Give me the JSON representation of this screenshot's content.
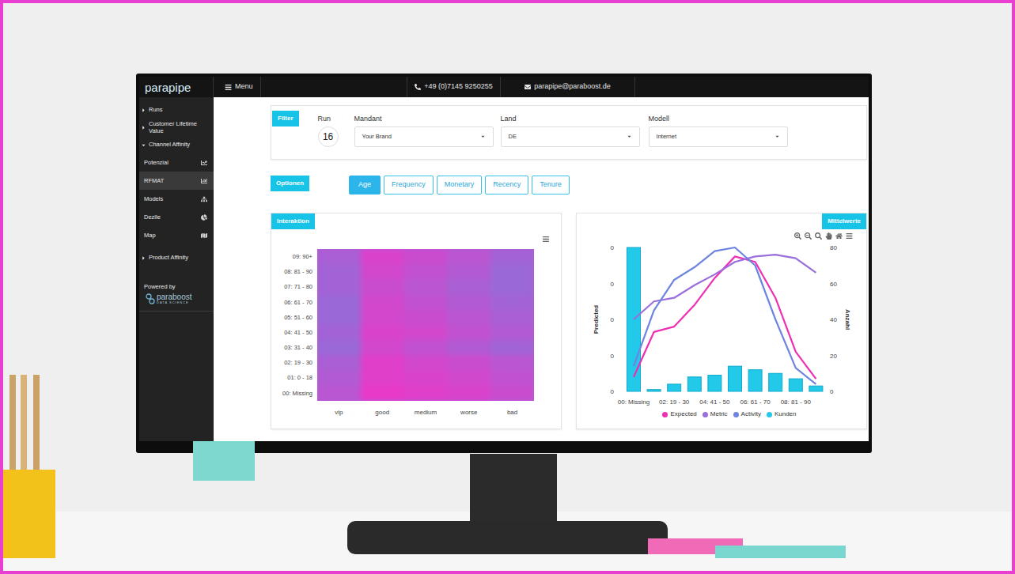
{
  "topbar": {
    "logo": "parapipe",
    "menu_label": "Menu",
    "phone": "+49 (0)7145 9250255",
    "email": "parapipe@paraboost.de"
  },
  "sidebar": {
    "items": [
      {
        "label": "Runs",
        "kind": "group",
        "expanded": false,
        "selected": false
      },
      {
        "label": "Customer Lifetime Value",
        "kind": "group",
        "expanded": false,
        "selected": false
      },
      {
        "label": "Channel Affinity",
        "kind": "group",
        "expanded": true,
        "selected": false
      },
      {
        "label": "Potenzial",
        "kind": "link",
        "selected": false
      },
      {
        "label": "RFMAT",
        "kind": "link",
        "selected": true
      },
      {
        "label": "Models",
        "kind": "link",
        "selected": false
      },
      {
        "label": "Dezile",
        "kind": "link",
        "selected": false
      },
      {
        "label": "Map",
        "kind": "link",
        "selected": false
      },
      {
        "label": "Product Affinity",
        "kind": "group",
        "expanded": false,
        "selected": false
      }
    ],
    "powered_by": "Powered by",
    "brand": "paraboost",
    "brand_tagline": "DATA SCIENCE"
  },
  "filter": {
    "title": "Filter",
    "run": {
      "label": "Run",
      "value": "16"
    },
    "selects": [
      {
        "label": "Mandant",
        "value": "Your Brand"
      },
      {
        "label": "Land",
        "value": "DE"
      },
      {
        "label": "Modell",
        "value": "Internet"
      }
    ]
  },
  "options": {
    "title": "Optionen",
    "tabs": [
      {
        "label": "Age",
        "selected": true
      },
      {
        "label": "Frequency",
        "selected": false
      },
      {
        "label": "Monetary",
        "selected": false
      },
      {
        "label": "Recency",
        "selected": false
      },
      {
        "label": "Tenure",
        "selected": false
      }
    ]
  },
  "heatmap": {
    "title": "Interaktion",
    "columns": [
      "vip",
      "good",
      "medium",
      "worse",
      "bad"
    ],
    "rows": [
      {
        "label": "09: 90+",
        "values": [
          0.6,
          0.9,
          0.8,
          0.7,
          0.55
        ]
      },
      {
        "label": "08: 81 - 90",
        "values": [
          0.55,
          0.85,
          0.75,
          0.65,
          0.5
        ]
      },
      {
        "label": "07: 71 - 80",
        "values": [
          0.55,
          0.8,
          0.7,
          0.6,
          0.5
        ]
      },
      {
        "label": "06: 61 - 70",
        "values": [
          0.5,
          0.85,
          0.75,
          0.65,
          0.55
        ]
      },
      {
        "label": "05: 51 - 60",
        "values": [
          0.5,
          0.85,
          0.8,
          0.7,
          0.6
        ]
      },
      {
        "label": "04: 41 - 50",
        "values": [
          0.55,
          0.9,
          0.85,
          0.75,
          0.65
        ]
      },
      {
        "label": "03: 31 - 40",
        "values": [
          0.5,
          0.85,
          0.75,
          0.65,
          0.55
        ]
      },
      {
        "label": "02: 19 - 30",
        "values": [
          0.6,
          0.95,
          0.85,
          0.8,
          0.7
        ]
      },
      {
        "label": "01: 0 - 18",
        "values": [
          0.65,
          0.95,
          0.9,
          0.85,
          0.75
        ]
      },
      {
        "label": "00: Missing",
        "values": [
          0.7,
          1,
          0.95,
          0.9,
          0.8
        ]
      }
    ]
  },
  "chart": {
    "title": "Mittelwerte",
    "left_axis": {
      "title": "Predicted",
      "ticks": [
        "0",
        "0",
        "0",
        "0",
        "0"
      ]
    },
    "right_axis": {
      "title": "Anzahl",
      "ticks": [
        "80",
        "60",
        "40",
        "20",
        "0"
      ],
      "max": 80
    },
    "x_labels": [
      "00: Missing",
      "02: 19 - 30",
      "04: 41 - 50",
      "06: 61 - 70",
      "08: 81 - 90"
    ],
    "bars": {
      "name": "Kunden",
      "color": "#22c9e8",
      "values": [
        80,
        1,
        4,
        8,
        9,
        14,
        12,
        10,
        7,
        3
      ]
    },
    "lines": [
      {
        "name": "Expected",
        "color": "#ee2fb4",
        "values": [
          8,
          33,
          36,
          48,
          63,
          75,
          72,
          52,
          22,
          7
        ]
      },
      {
        "name": "Metric",
        "color": "#9a6fdc",
        "values": [
          40,
          50,
          52,
          59,
          65,
          72,
          75,
          76,
          74,
          66
        ]
      },
      {
        "name": "Activity",
        "color": "#6d84e0",
        "values": [
          14,
          45,
          62,
          69,
          78,
          80,
          70,
          40,
          13,
          4
        ]
      }
    ]
  }
}
